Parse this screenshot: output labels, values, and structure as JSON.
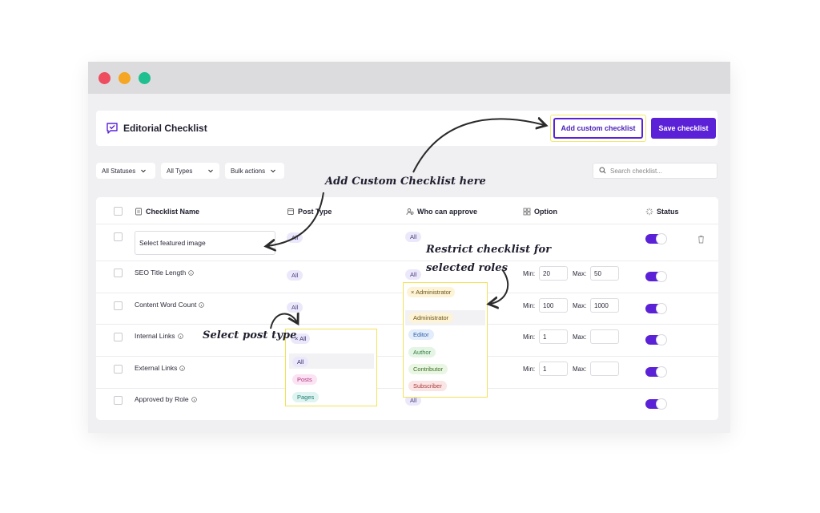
{
  "header": {
    "title": "Editorial Checklist",
    "add_button": "Add custom checklist",
    "save_button": "Save checklist"
  },
  "filters": {
    "statuses": "All Statuses",
    "types": "All Types",
    "bulk": "Bulk actions",
    "search_placeholder": "Search checklist..."
  },
  "table": {
    "columns": {
      "name": "Checklist Name",
      "post_type": "Post Type",
      "who": "Who can approve",
      "option": "Option",
      "status": "Status"
    },
    "rows": [
      {
        "name": "Select featured image",
        "post_type": "All",
        "who": "All"
      },
      {
        "name": "SEO Title Length",
        "post_type": "All",
        "who": "All",
        "min_label": "Min:",
        "min": "20",
        "max_label": "Max:",
        "max": "50"
      },
      {
        "name": "Content Word Count",
        "post_type": "All",
        "min_label": "Min:",
        "min": "100",
        "max_label": "Max:",
        "max": "1000"
      },
      {
        "name": "Internal Links",
        "min_label": "Min:",
        "min": "1",
        "max_label": "Max:",
        "max": ""
      },
      {
        "name": "External Links",
        "min_label": "Min:",
        "min": "1",
        "max_label": "Max:",
        "max": ""
      },
      {
        "name": "Approved by Role",
        "who": "All"
      }
    ]
  },
  "post_type_dropdown": {
    "selected": "All",
    "options": [
      "All",
      "Posts",
      "Pages"
    ]
  },
  "roles_dropdown": {
    "selected": "Administrator",
    "options": [
      "Administrator",
      "Editor",
      "Author",
      "Contributor",
      "Subscriber"
    ]
  },
  "annotations": {
    "add_custom": "Add Custom Checklist here",
    "restrict_line1": "Restrict checklist for",
    "restrict_line2": "selected roles",
    "select_post": "Select post type"
  },
  "colors": {
    "accent": "#5b21d6",
    "highlight": "#f2e25a"
  }
}
